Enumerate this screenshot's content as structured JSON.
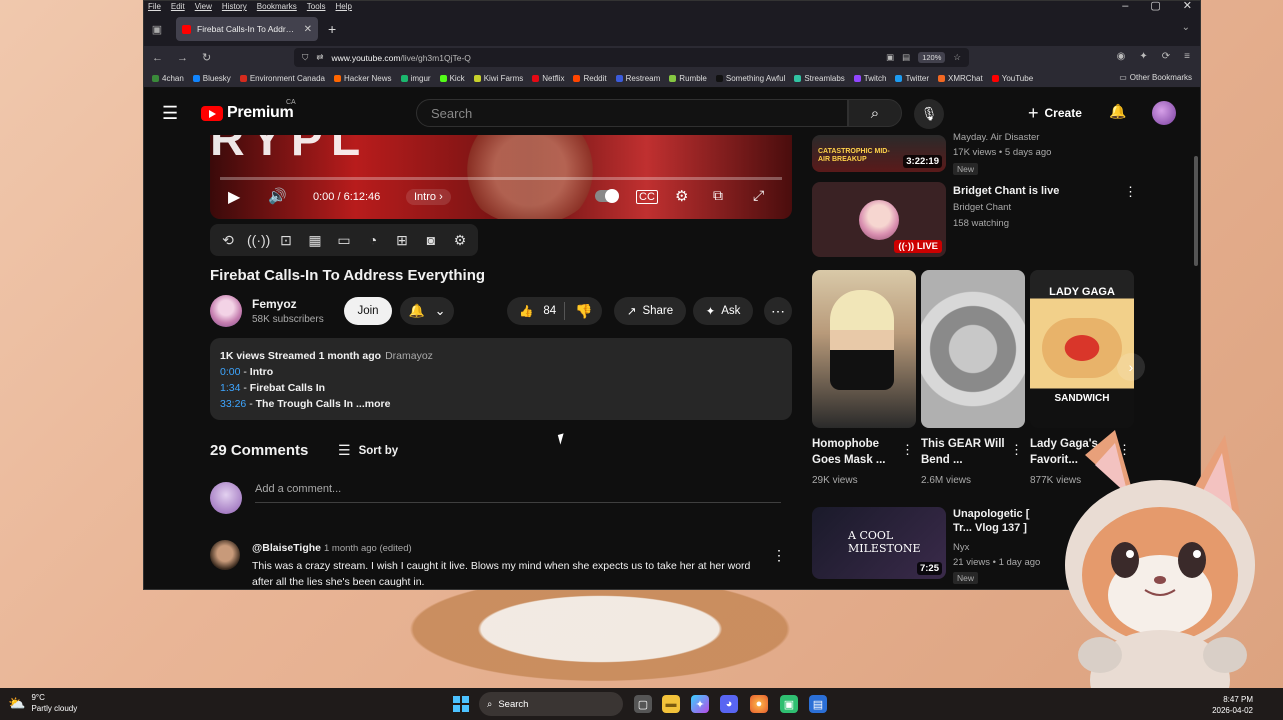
{
  "browser": {
    "menu": [
      "File",
      "Edit",
      "View",
      "History",
      "Bookmarks",
      "Tools",
      "Help"
    ],
    "tab_title": "Firebat Calls-In To Address Eve",
    "url_domain": "www.youtube.com",
    "url_path": "/live/gh3m1QjTe-Q",
    "zoom": "120%",
    "bookmarks": [
      {
        "label": "4chan",
        "color": "#3a8a3a"
      },
      {
        "label": "Bluesky",
        "color": "#1185fe"
      },
      {
        "label": "Environment Canada",
        "color": "#d52b1e"
      },
      {
        "label": "Hacker News",
        "color": "#ff6600"
      },
      {
        "label": "imgur",
        "color": "#1bb76e"
      },
      {
        "label": "Kick",
        "color": "#53fc18"
      },
      {
        "label": "Kiwi Farms",
        "color": "#c7d12b"
      },
      {
        "label": "Netflix",
        "color": "#e50914"
      },
      {
        "label": "Reddit",
        "color": "#ff4500"
      },
      {
        "label": "Restream",
        "color": "#3b5bdb"
      },
      {
        "label": "Rumble",
        "color": "#85c742"
      },
      {
        "label": "Something Awful",
        "color": "#111111"
      },
      {
        "label": "Streamlabs",
        "color": "#31c3a2"
      },
      {
        "label": "Twitch",
        "color": "#9146ff"
      },
      {
        "label": "Twitter",
        "color": "#1d9bf0"
      },
      {
        "label": "XMRChat",
        "color": "#f26822"
      },
      {
        "label": "YouTube",
        "color": "#ff0000"
      }
    ],
    "other_bookmarks": "Other Bookmarks"
  },
  "yt": {
    "logo_text": "Premium",
    "region": "CA",
    "search_placeholder": "Search",
    "create_label": "Create"
  },
  "player": {
    "banner_text": "RYPL",
    "time": "0:00 / 6:12:46",
    "chapter": "Intro",
    "progress": 0.0
  },
  "video": {
    "title": "Firebat Calls-In To Address Everything",
    "channel": "Femyoz",
    "subscribers": "58K subscribers",
    "join_label": "Join",
    "likes": "84",
    "share_label": "Share",
    "ask_label": "Ask"
  },
  "description": {
    "meta": "1K views  Streamed 1 month ago",
    "tag": "Dramayoz",
    "chapters": [
      {
        "time": "0:00",
        "title": "Intro"
      },
      {
        "time": "1:34",
        "title": "Firebat Calls In"
      },
      {
        "time": "33:26",
        "title": "The Trough Calls In"
      }
    ],
    "more_label": "...more"
  },
  "comments": {
    "count_label": "29 Comments",
    "sort_label": "Sort by",
    "add_placeholder": "Add a comment...",
    "items": [
      {
        "author": "@BlaiseTighe",
        "meta": "1 month ago (edited)",
        "text": "This was a crazy stream. I wish I caught it live. Blows my mind when she expects us to take her at her word after all the lies she's been caught in."
      }
    ]
  },
  "sidebar": {
    "top_partial": {
      "title": "Mayday. Air Disaster",
      "views": "17K views • 5 days ago",
      "badge": "New",
      "duration": "3:22:19",
      "thumb_text": "CATASTROPHIC MID-AIR BREAKUP"
    },
    "live_item": {
      "title": "Bridget Chant is live",
      "channel": "Bridget Chant",
      "watching": "158 watching",
      "badge": "LIVE"
    },
    "shorts": [
      {
        "title": "Homophobe Goes Mask ...",
        "views": "29K views"
      },
      {
        "title": "This GEAR Will Bend ...",
        "views": "2.6M views"
      },
      {
        "title": "Lady Gaga's Favorit...",
        "views": "877K views",
        "thumb_top": "LADY GAGA",
        "thumb_bottom": "SANDWICH"
      }
    ],
    "bottom_item": {
      "title": "Unapologetic [ Tr... Vlog 137 ]",
      "channel": "Nyx",
      "views": "21 views • 1 day ago",
      "badge": "New",
      "duration": "7:25",
      "thumb_text": "A COOL MILESTONE"
    }
  },
  "taskbar": {
    "temp": "9°C",
    "weather": "Partly cloudy",
    "search_label": "Search",
    "time": "8:47 PM",
    "date": "2026-04-02"
  }
}
